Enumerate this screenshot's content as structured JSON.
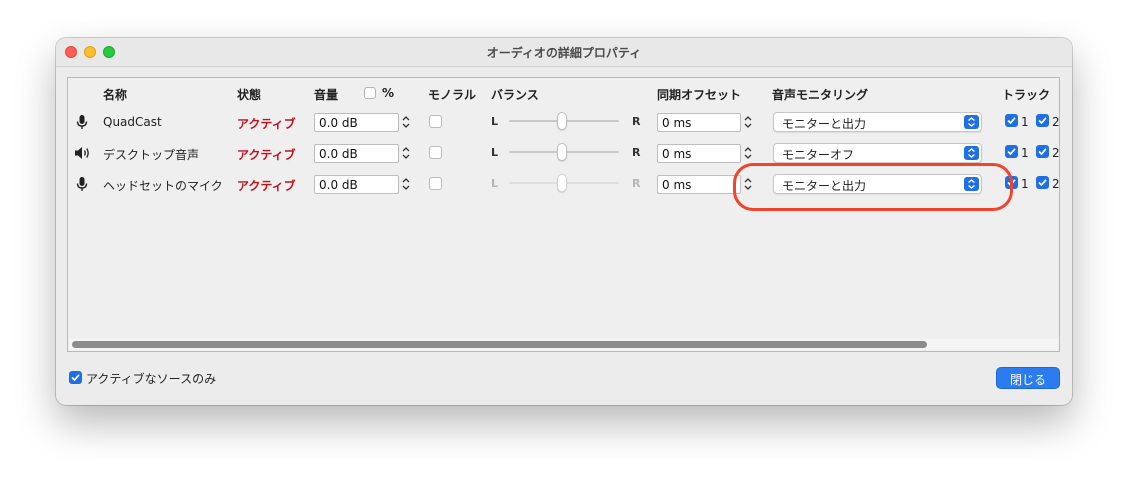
{
  "window": {
    "title": "オーディオの詳細プロパティ"
  },
  "columns": {
    "name": "名称",
    "status": "状態",
    "volume": "音量",
    "percent": "%",
    "mono": "モノラル",
    "balance": "バランス",
    "sync_offset": "同期オフセット",
    "monitoring": "音声モニタリング",
    "tracks": "トラック"
  },
  "balance_labels": {
    "left": "L",
    "right": "R"
  },
  "rows": [
    {
      "icon": "microphone-icon",
      "name": "QuadCast",
      "status": "アクティブ",
      "volume": "0.0 dB",
      "mono": false,
      "balance": 0.5,
      "balance_enabled": true,
      "sync_offset": "0 ms",
      "monitoring": "モニターと出力",
      "track1_label": "1",
      "track2_label": "2",
      "track1": true,
      "track2": true
    },
    {
      "icon": "speaker-icon",
      "name": "デスクトップ音声",
      "status": "アクティブ",
      "volume": "0.0 dB",
      "mono": false,
      "balance": 0.5,
      "balance_enabled": true,
      "sync_offset": "0 ms",
      "monitoring": "モニターオフ",
      "track1_label": "1",
      "track2_label": "2",
      "track1": true,
      "track2": true
    },
    {
      "icon": "microphone-icon",
      "name": "ヘッドセットのマイク",
      "status": "アクティブ",
      "volume": "0.0 dB",
      "mono": false,
      "balance": 0.5,
      "balance_enabled": false,
      "sync_offset": "0 ms",
      "monitoring": "モニターと出力",
      "track1_label": "1",
      "track2_label": "2",
      "track1": true,
      "track2": true
    }
  ],
  "footer": {
    "active_only_label": "アクティブなソースのみ",
    "active_only_checked": true,
    "close_button": "閉じる"
  },
  "colors": {
    "status_active": "#c1121c",
    "accent": "#1f6fe5",
    "annotation": "#f0452b"
  }
}
